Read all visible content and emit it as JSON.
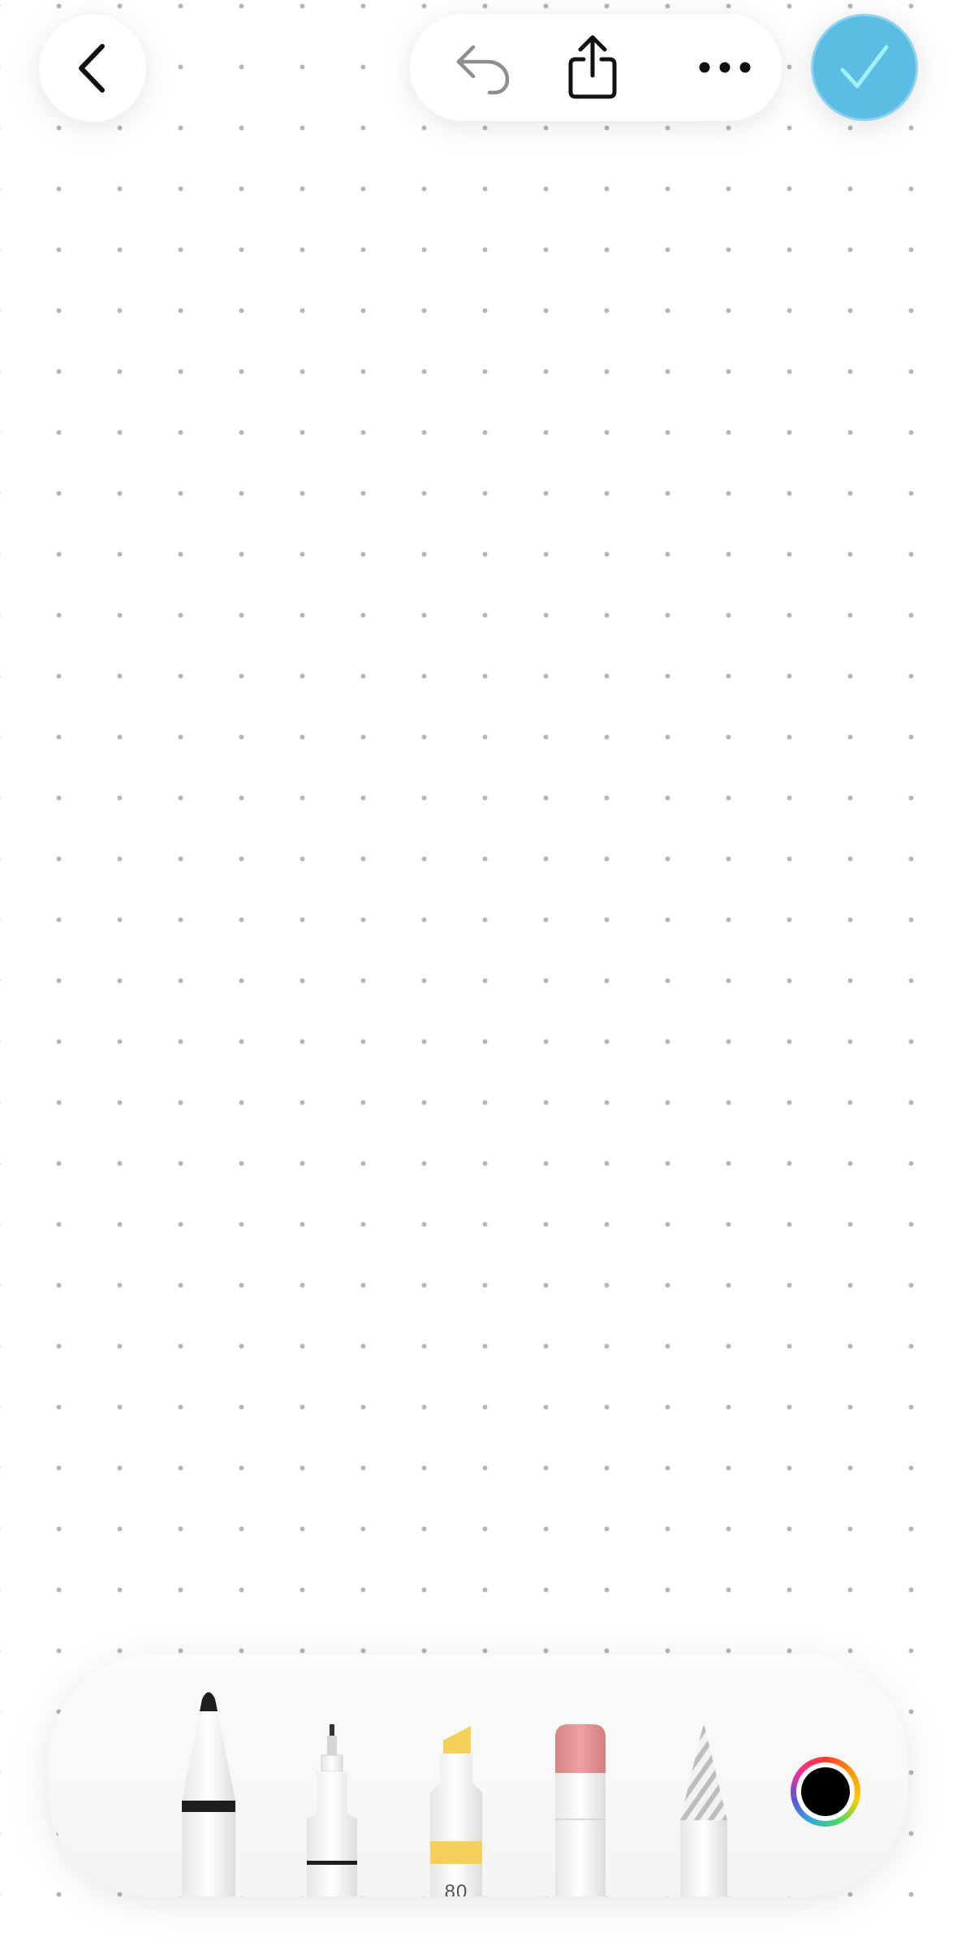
{
  "topbar": {
    "back_icon": "chevron-left-icon",
    "undo_icon": "undo-arrow-icon",
    "share_icon": "share-icon",
    "more_icon": "ellipsis-icon",
    "done_icon": "checkmark-icon"
  },
  "toolbar": {
    "tools": [
      {
        "name": "pen",
        "icon": "pen-tool-icon"
      },
      {
        "name": "fineliner",
        "icon": "fineliner-tool-icon"
      },
      {
        "name": "highlighter",
        "icon": "highlighter-tool-icon",
        "label": "80"
      },
      {
        "name": "eraser",
        "icon": "eraser-tool-icon"
      },
      {
        "name": "pencil",
        "icon": "pencil-tool-icon"
      }
    ],
    "current_color": "#000000"
  },
  "colors": {
    "accent": "#5bbce4",
    "highlighter": "#f4cf5a",
    "eraser": "#e8999a"
  }
}
